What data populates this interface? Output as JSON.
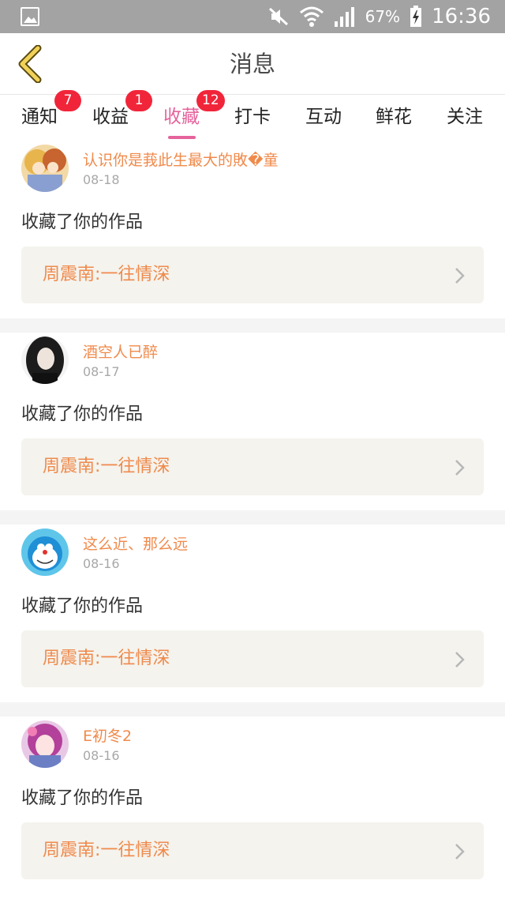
{
  "status_bar": {
    "battery": "67%",
    "time": "16:36",
    "icons": [
      "gallery-icon",
      "mute-icon",
      "wifi-icon",
      "signal-icon",
      "battery-charging-icon"
    ]
  },
  "header": {
    "title": "消息",
    "back_icon": "chevron-left-icon"
  },
  "tabs": [
    {
      "label": "通知",
      "badge": "7"
    },
    {
      "label": "收益",
      "badge": "1"
    },
    {
      "label": "收藏",
      "badge": "12",
      "active": true
    },
    {
      "label": "打卡"
    },
    {
      "label": "互动"
    },
    {
      "label": "鲜花"
    },
    {
      "label": "关注"
    }
  ],
  "messages": [
    {
      "user": "认识你是莪此生最大的敗�童",
      "date": "08-18",
      "action": "收藏了你的作品",
      "work": "周震南:一往情深"
    },
    {
      "user": "酒空人已醉",
      "date": "08-17",
      "action": "收藏了你的作品",
      "work": "周震南:一往情深"
    },
    {
      "user": "这么近、那么远",
      "date": "08-16",
      "action": "收藏了你的作品",
      "work": "周震南:一往情深"
    },
    {
      "user": "E初冬2",
      "date": "08-16",
      "action": "收藏了你的作品",
      "work": "周震南:一往情深"
    }
  ],
  "colors": {
    "status_bar": "#a3a3a3",
    "accent_pink": "#e5639c",
    "username_orange": "#f08a4b",
    "badge_red": "#f1253a",
    "back_icon_yellow": "#f0d25a",
    "work_box_bg": "#f4f3ee"
  }
}
